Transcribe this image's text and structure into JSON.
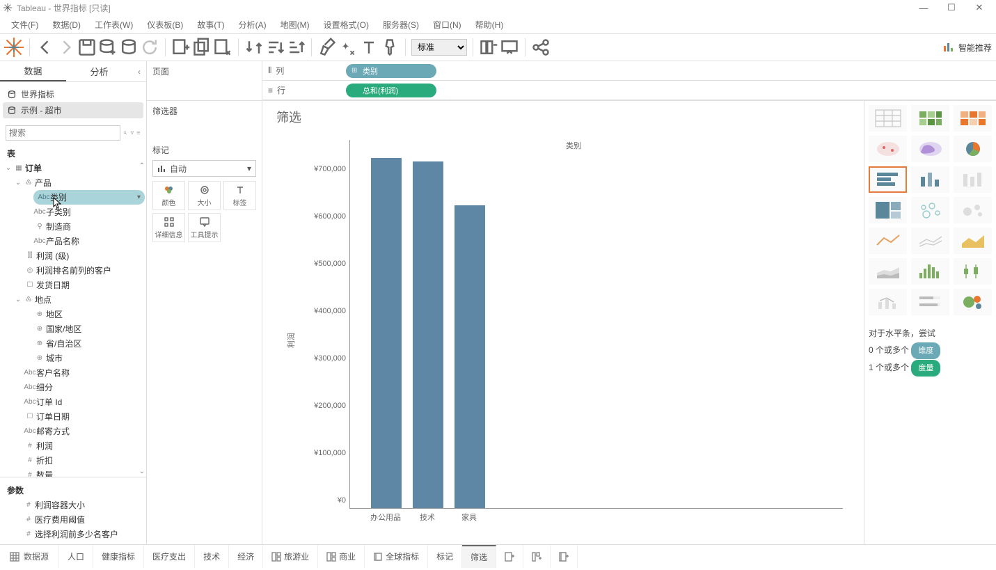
{
  "titlebar": {
    "text": "Tableau - 世界指标 [只读]"
  },
  "menu": [
    "文件(F)",
    "数据(D)",
    "工作表(W)",
    "仪表板(B)",
    "故事(T)",
    "分析(A)",
    "地图(M)",
    "设置格式(O)",
    "服务器(S)",
    "窗口(N)",
    "帮助(H)"
  ],
  "toolbar": {
    "standard": "标准",
    "showme": "智能推荐"
  },
  "datapane": {
    "tab_data": "数据",
    "tab_analysis": "分析",
    "sources": [
      "世界指标",
      "示例 - 超市"
    ],
    "search_placeholder": "搜索",
    "table_heading": "表",
    "params_heading": "参数",
    "tree": {
      "orders": "订单",
      "product": "产品",
      "category": "类别",
      "subcategory": "子类别",
      "manufacturer": "制造商",
      "product_name": "产品名称",
      "profit_level": "利润 (级)",
      "top_customers": "利润排名前列的客户",
      "ship_date": "发货日期",
      "location": "地点",
      "region": "地区",
      "country": "国家/地区",
      "province": "省/自治区",
      "city": "城市",
      "customer_name": "客户名称",
      "segment": "细分",
      "order_id": "订单 Id",
      "order_date": "订单日期",
      "ship_mode": "邮寄方式",
      "profit": "利润",
      "discount": "折扣",
      "quantity": "数量"
    },
    "params": {
      "p1": "利润容器大小",
      "p2": "医疗费用阈值",
      "p3": "选择利润前多少名客户"
    }
  },
  "cards": {
    "pages": "页面",
    "filters": "筛选器",
    "marks": "标记",
    "auto": "自动",
    "color": "颜色",
    "size": "大小",
    "label": "标签",
    "detail": "详细信息",
    "tooltip": "工具提示"
  },
  "shelves": {
    "columns": "列",
    "rows": "行",
    "col_pill": "类别",
    "row_pill": "总和(利润)"
  },
  "viz": {
    "title": "筛选",
    "x_title": "类别",
    "y_title": "利润"
  },
  "chart_data": {
    "type": "bar",
    "categories": [
      "办公用品",
      "技术",
      "家具"
    ],
    "values": [
      740000,
      733000,
      640000
    ],
    "xlabel": "类别",
    "ylabel": "利润",
    "ylim": [
      0,
      750000
    ],
    "yticks": [
      0,
      100000,
      200000,
      300000,
      400000,
      500000,
      600000,
      700000
    ],
    "ytick_labels": [
      "¥0",
      "¥100,000",
      "¥200,000",
      "¥300,000",
      "¥400,000",
      "¥500,000",
      "¥600,000",
      "¥700,000"
    ]
  },
  "showme": {
    "hint_title": "对于水平条，尝试",
    "hint1_a": "0 个或多个",
    "hint1_b": "维度",
    "hint2_a": "1 个或多个",
    "hint2_b": "度量"
  },
  "sheets": {
    "datasource": "数据源",
    "tabs": [
      "人口",
      "健康指标",
      "医疗支出",
      "技术",
      "经济"
    ],
    "dash_tabs": [
      "旅游业",
      "商业"
    ],
    "story": "全球指标",
    "extra": [
      "标记",
      "筛选"
    ]
  }
}
